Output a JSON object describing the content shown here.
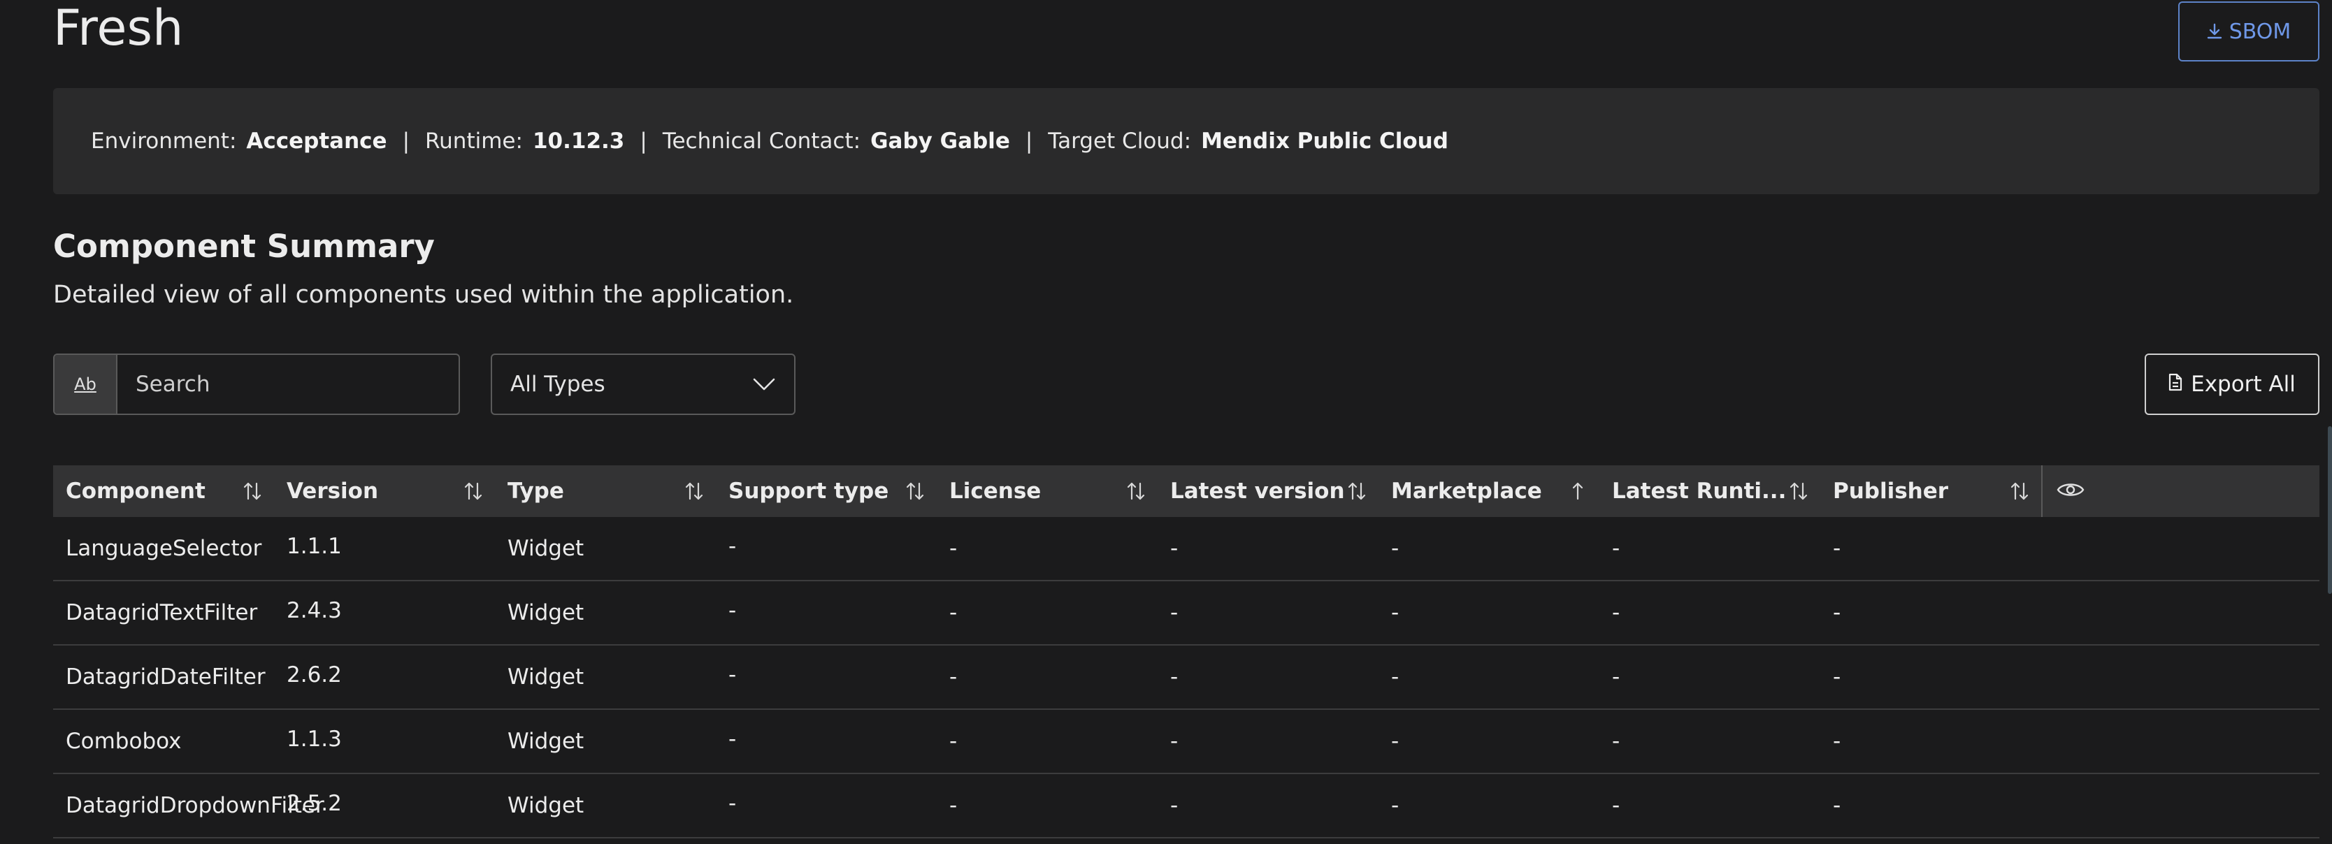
{
  "page": {
    "title": "Fresh",
    "sbom_label": "SBOM"
  },
  "info": {
    "environment_label": "Environment:",
    "environment_value": "Acceptance",
    "runtime_label": "Runtime:",
    "runtime_value": "10.12.3",
    "contact_label": "Technical Contact:",
    "contact_value": "Gaby Gable",
    "cloud_label": "Target Cloud:",
    "cloud_value": "Mendix Public Cloud",
    "separator": "|"
  },
  "summary": {
    "title": "Component Summary",
    "subtitle": "Detailed view of all components used within the application."
  },
  "filters": {
    "search_type_label": "Ab",
    "search_placeholder": "Search",
    "type_select_value": "All Types",
    "export_label": "Export All"
  },
  "table": {
    "columns": [
      {
        "label": "Component",
        "sort": "both"
      },
      {
        "label": "Version",
        "sort": "both"
      },
      {
        "label": "Type",
        "sort": "both"
      },
      {
        "label": "Support type",
        "sort": "both"
      },
      {
        "label": "License",
        "sort": "both"
      },
      {
        "label": "Latest version",
        "sort": "both"
      },
      {
        "label": "Marketplace",
        "sort": "asc"
      },
      {
        "label": "Latest Runti...",
        "sort": "both"
      },
      {
        "label": "Publisher",
        "sort": "both"
      }
    ],
    "rows": [
      [
        "LanguageSelector",
        "1.1.1",
        "Widget",
        "-",
        "-",
        "-",
        "-",
        "-",
        "-"
      ],
      [
        "DatagridTextFilter",
        "2.4.3",
        "Widget",
        "-",
        "-",
        "-",
        "-",
        "-",
        "-"
      ],
      [
        "DatagridDateFilter",
        "2.6.2",
        "Widget",
        "-",
        "-",
        "-",
        "-",
        "-",
        "-"
      ],
      [
        "Combobox",
        "1.1.3",
        "Widget",
        "-",
        "-",
        "-",
        "-",
        "-",
        "-"
      ],
      [
        "DatagridDropdownFilter",
        "2.5.2",
        "Widget",
        "-",
        "-",
        "-",
        "-",
        "-",
        "-"
      ]
    ]
  },
  "icons": {
    "sbom": "download-icon",
    "export": "document-icon",
    "select": "chevron-down-icon",
    "sort_both": "sort-icon",
    "sort_asc": "sort-ascending-icon",
    "columns": "eye-icon"
  },
  "colors": {
    "background": "#1b1b1c",
    "panel": "#2a2a2b",
    "accent": "#6f98e8"
  }
}
